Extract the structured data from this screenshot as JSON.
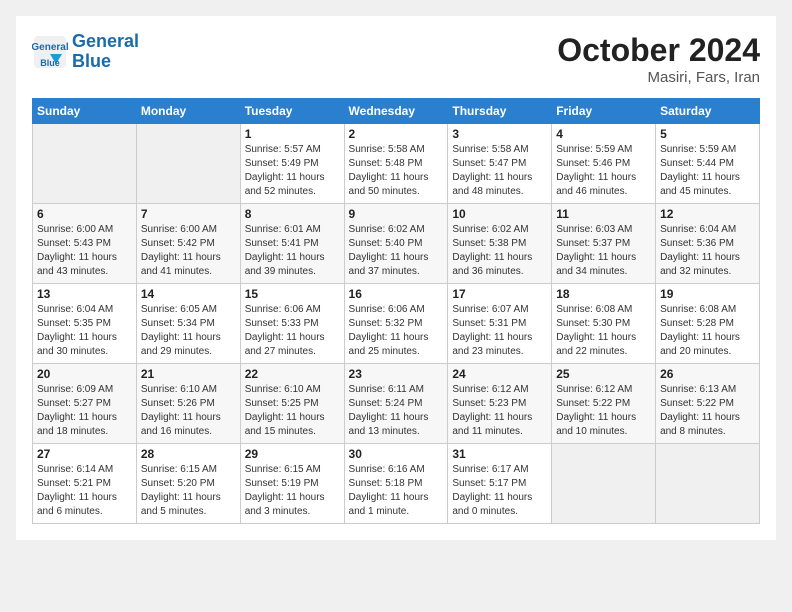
{
  "header": {
    "logo_line1": "General",
    "logo_line2": "Blue",
    "month_title": "October 2024",
    "location": "Masiri, Fars, Iran"
  },
  "weekdays": [
    "Sunday",
    "Monday",
    "Tuesday",
    "Wednesday",
    "Thursday",
    "Friday",
    "Saturday"
  ],
  "weeks": [
    [
      {
        "day": "",
        "info": ""
      },
      {
        "day": "",
        "info": ""
      },
      {
        "day": "1",
        "info": "Sunrise: 5:57 AM\nSunset: 5:49 PM\nDaylight: 11 hours\nand 52 minutes."
      },
      {
        "day": "2",
        "info": "Sunrise: 5:58 AM\nSunset: 5:48 PM\nDaylight: 11 hours\nand 50 minutes."
      },
      {
        "day": "3",
        "info": "Sunrise: 5:58 AM\nSunset: 5:47 PM\nDaylight: 11 hours\nand 48 minutes."
      },
      {
        "day": "4",
        "info": "Sunrise: 5:59 AM\nSunset: 5:46 PM\nDaylight: 11 hours\nand 46 minutes."
      },
      {
        "day": "5",
        "info": "Sunrise: 5:59 AM\nSunset: 5:44 PM\nDaylight: 11 hours\nand 45 minutes."
      }
    ],
    [
      {
        "day": "6",
        "info": "Sunrise: 6:00 AM\nSunset: 5:43 PM\nDaylight: 11 hours\nand 43 minutes."
      },
      {
        "day": "7",
        "info": "Sunrise: 6:00 AM\nSunset: 5:42 PM\nDaylight: 11 hours\nand 41 minutes."
      },
      {
        "day": "8",
        "info": "Sunrise: 6:01 AM\nSunset: 5:41 PM\nDaylight: 11 hours\nand 39 minutes."
      },
      {
        "day": "9",
        "info": "Sunrise: 6:02 AM\nSunset: 5:40 PM\nDaylight: 11 hours\nand 37 minutes."
      },
      {
        "day": "10",
        "info": "Sunrise: 6:02 AM\nSunset: 5:38 PM\nDaylight: 11 hours\nand 36 minutes."
      },
      {
        "day": "11",
        "info": "Sunrise: 6:03 AM\nSunset: 5:37 PM\nDaylight: 11 hours\nand 34 minutes."
      },
      {
        "day": "12",
        "info": "Sunrise: 6:04 AM\nSunset: 5:36 PM\nDaylight: 11 hours\nand 32 minutes."
      }
    ],
    [
      {
        "day": "13",
        "info": "Sunrise: 6:04 AM\nSunset: 5:35 PM\nDaylight: 11 hours\nand 30 minutes."
      },
      {
        "day": "14",
        "info": "Sunrise: 6:05 AM\nSunset: 5:34 PM\nDaylight: 11 hours\nand 29 minutes."
      },
      {
        "day": "15",
        "info": "Sunrise: 6:06 AM\nSunset: 5:33 PM\nDaylight: 11 hours\nand 27 minutes."
      },
      {
        "day": "16",
        "info": "Sunrise: 6:06 AM\nSunset: 5:32 PM\nDaylight: 11 hours\nand 25 minutes."
      },
      {
        "day": "17",
        "info": "Sunrise: 6:07 AM\nSunset: 5:31 PM\nDaylight: 11 hours\nand 23 minutes."
      },
      {
        "day": "18",
        "info": "Sunrise: 6:08 AM\nSunset: 5:30 PM\nDaylight: 11 hours\nand 22 minutes."
      },
      {
        "day": "19",
        "info": "Sunrise: 6:08 AM\nSunset: 5:28 PM\nDaylight: 11 hours\nand 20 minutes."
      }
    ],
    [
      {
        "day": "20",
        "info": "Sunrise: 6:09 AM\nSunset: 5:27 PM\nDaylight: 11 hours\nand 18 minutes."
      },
      {
        "day": "21",
        "info": "Sunrise: 6:10 AM\nSunset: 5:26 PM\nDaylight: 11 hours\nand 16 minutes."
      },
      {
        "day": "22",
        "info": "Sunrise: 6:10 AM\nSunset: 5:25 PM\nDaylight: 11 hours\nand 15 minutes."
      },
      {
        "day": "23",
        "info": "Sunrise: 6:11 AM\nSunset: 5:24 PM\nDaylight: 11 hours\nand 13 minutes."
      },
      {
        "day": "24",
        "info": "Sunrise: 6:12 AM\nSunset: 5:23 PM\nDaylight: 11 hours\nand 11 minutes."
      },
      {
        "day": "25",
        "info": "Sunrise: 6:12 AM\nSunset: 5:22 PM\nDaylight: 11 hours\nand 10 minutes."
      },
      {
        "day": "26",
        "info": "Sunrise: 6:13 AM\nSunset: 5:22 PM\nDaylight: 11 hours\nand 8 minutes."
      }
    ],
    [
      {
        "day": "27",
        "info": "Sunrise: 6:14 AM\nSunset: 5:21 PM\nDaylight: 11 hours\nand 6 minutes."
      },
      {
        "day": "28",
        "info": "Sunrise: 6:15 AM\nSunset: 5:20 PM\nDaylight: 11 hours\nand 5 minutes."
      },
      {
        "day": "29",
        "info": "Sunrise: 6:15 AM\nSunset: 5:19 PM\nDaylight: 11 hours\nand 3 minutes."
      },
      {
        "day": "30",
        "info": "Sunrise: 6:16 AM\nSunset: 5:18 PM\nDaylight: 11 hours\nand 1 minute."
      },
      {
        "day": "31",
        "info": "Sunrise: 6:17 AM\nSunset: 5:17 PM\nDaylight: 11 hours\nand 0 minutes."
      },
      {
        "day": "",
        "info": ""
      },
      {
        "day": "",
        "info": ""
      }
    ]
  ]
}
